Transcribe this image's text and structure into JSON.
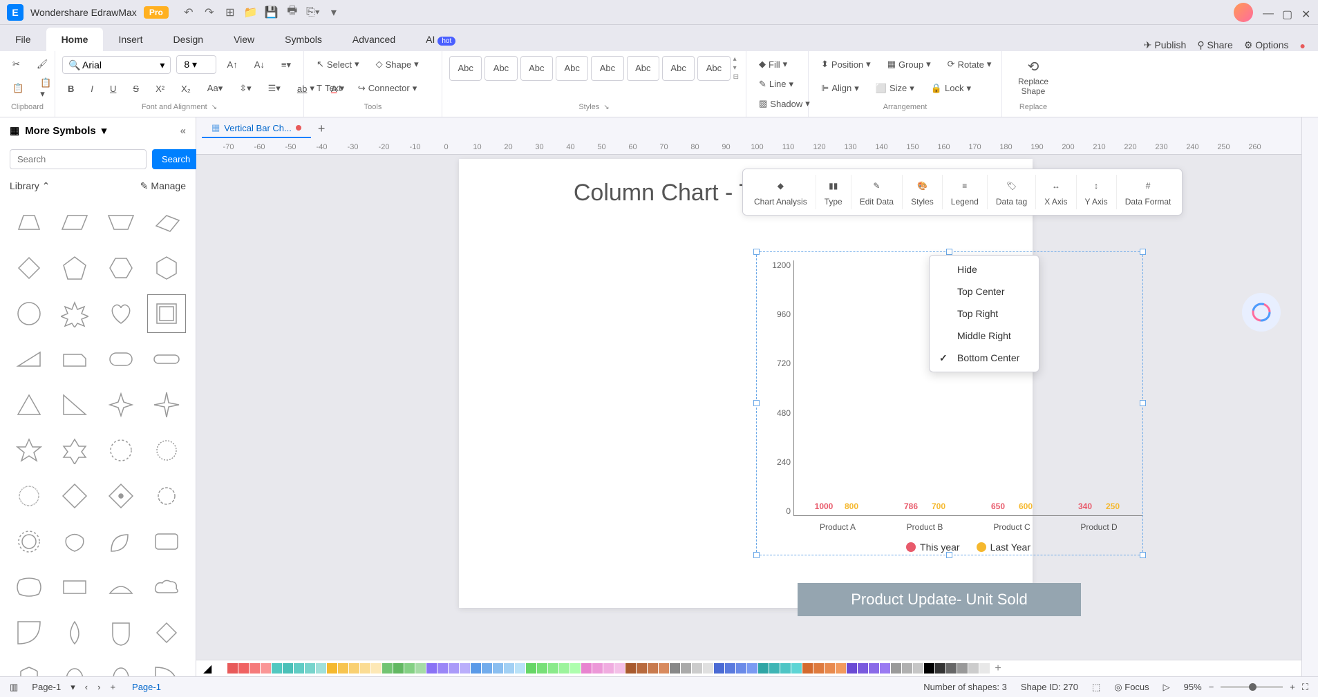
{
  "app": {
    "title": "Wondershare EdrawMax",
    "pro": "Pro"
  },
  "menu": {
    "tabs": [
      "File",
      "Home",
      "Insert",
      "Design",
      "View",
      "Symbols",
      "Advanced",
      "AI"
    ],
    "active": 1,
    "hot": "hot",
    "right": {
      "publish": "Publish",
      "share": "Share",
      "options": "Options"
    }
  },
  "ribbon": {
    "font_name": "Arial",
    "font_size": "8",
    "select": "Select",
    "text": "Text",
    "shape": "Shape",
    "connector": "Connector",
    "fill": "Fill",
    "line": "Line",
    "shadow": "Shadow",
    "position": "Position",
    "group": "Group",
    "rotate": "Rotate",
    "align": "Align",
    "size": "Size",
    "lock": "Lock",
    "replace_shape": "Replace\nShape",
    "groups": {
      "clipboard": "Clipboard",
      "font": "Font and Alignment",
      "tools": "Tools",
      "styles": "Styles",
      "arrangement": "Arrangement",
      "replace": "Replace"
    },
    "style_preset": "Abc"
  },
  "sidebar": {
    "title": "More Symbols",
    "search_placeholder": "Search",
    "search_btn": "Search",
    "library": "Library",
    "manage": "Manage"
  },
  "doc_tab": {
    "name": "Vertical Bar Ch..."
  },
  "ruler": [
    -70,
    -60,
    -50,
    -40,
    -30,
    -20,
    -10,
    0,
    10,
    20,
    30,
    40,
    50,
    60,
    70,
    80,
    90,
    100,
    110,
    120,
    130,
    140,
    150,
    160,
    170,
    180,
    190,
    200,
    210,
    220,
    230,
    240,
    250,
    260
  ],
  "chart_toolbar": [
    "Chart Analysis",
    "Type",
    "Edit Data",
    "Styles",
    "Legend",
    "Data tag",
    "X Axis",
    "Y Axis",
    "Data Format"
  ],
  "legend_menu": {
    "items": [
      "Hide",
      "Top Center",
      "Top Right",
      "Middle Right",
      "Bottom Center"
    ],
    "checked": 4
  },
  "chart_data": {
    "type": "bar",
    "title": "Column Chart - This vs Last Year",
    "categories": [
      "Product A",
      "Product B",
      "Product C",
      "Product D"
    ],
    "series": [
      {
        "name": "This year",
        "values": [
          1000,
          786,
          650,
          340
        ],
        "color": "#e85a6b"
      },
      {
        "name": "Last Year",
        "values": [
          800,
          700,
          600,
          250
        ],
        "color": "#f5b82e"
      }
    ],
    "ylim": [
      0,
      1200
    ],
    "yticks": [
      1200,
      960,
      720,
      480,
      240,
      0
    ],
    "ylabel": "",
    "xlabel": ""
  },
  "caption": "Product Update- Unit Sold",
  "colors": [
    "#ffffff",
    "#e85a5a",
    "#f06262",
    "#f57a7a",
    "#fa9696",
    "#52c8c0",
    "#4ac0b8",
    "#60ccc4",
    "#78d4cc",
    "#a0e0da",
    "#f5b82e",
    "#f7c450",
    "#f9d072",
    "#fbdc94",
    "#fde8b6",
    "#72c472",
    "#62b862",
    "#84d084",
    "#a6dca6",
    "#8a72f5",
    "#9a86f7",
    "#aa9af9",
    "#baaefb",
    "#5a9ae8",
    "#72acec",
    "#8abef0",
    "#a2d0f4",
    "#bae2f8",
    "#66d666",
    "#78e078",
    "#8aea8a",
    "#9cf49c",
    "#aefeae",
    "#e884d0",
    "#ec98d8",
    "#f0ace0",
    "#f4c0e8",
    "#a85a2e",
    "#b86a3e",
    "#c87a4e",
    "#d88a5e",
    "#888888",
    "#aaaaaa",
    "#cccccc",
    "#e0e0e0",
    "#4a6ad4",
    "#5a7ade",
    "#6a8ae8",
    "#7a9af2",
    "#2ea5a5",
    "#3eb5b5",
    "#4ec5c5",
    "#5ed5d5",
    "#d46a2e",
    "#de7a3e",
    "#e88a4e",
    "#f29a5e",
    "#6a4ad4",
    "#7a5ade",
    "#8a6ae8",
    "#9a7af2",
    "#9a9a9a",
    "#b0b0b0",
    "#c6c6c6",
    "#000000",
    "#333333",
    "#666666",
    "#999999",
    "#cccccc",
    "#e8e8e8"
  ],
  "status": {
    "page_select": "Page-1",
    "page_current": "Page-1",
    "shape_count": "Number of shapes: 3",
    "shape_id": "Shape ID: 270",
    "focus": "Focus",
    "zoom": "95%"
  }
}
